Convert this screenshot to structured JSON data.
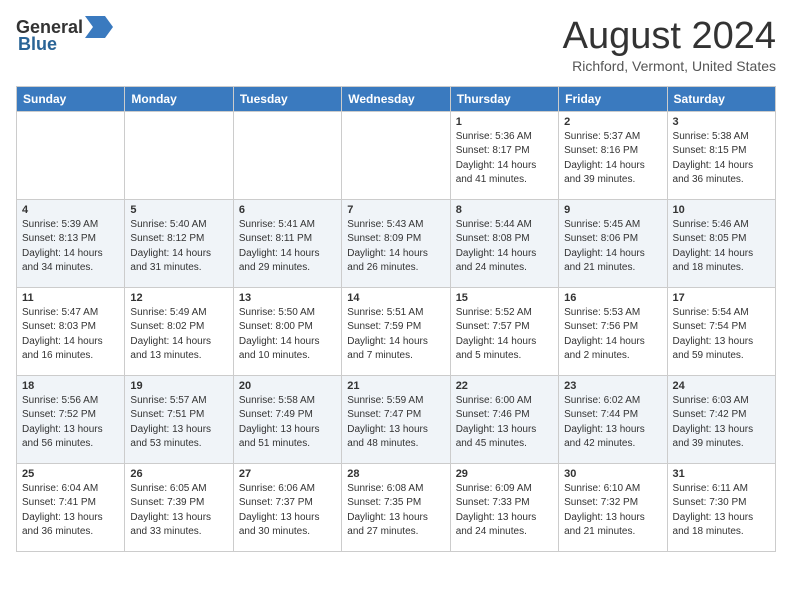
{
  "header": {
    "logo_general": "General",
    "logo_blue": "Blue",
    "month_title": "August 2024",
    "location": "Richford, Vermont, United States"
  },
  "days_of_week": [
    "Sunday",
    "Monday",
    "Tuesday",
    "Wednesday",
    "Thursday",
    "Friday",
    "Saturday"
  ],
  "weeks": [
    [
      {
        "day": "",
        "info": ""
      },
      {
        "day": "",
        "info": ""
      },
      {
        "day": "",
        "info": ""
      },
      {
        "day": "",
        "info": ""
      },
      {
        "day": "1",
        "info": "Sunrise: 5:36 AM\nSunset: 8:17 PM\nDaylight: 14 hours\nand 41 minutes."
      },
      {
        "day": "2",
        "info": "Sunrise: 5:37 AM\nSunset: 8:16 PM\nDaylight: 14 hours\nand 39 minutes."
      },
      {
        "day": "3",
        "info": "Sunrise: 5:38 AM\nSunset: 8:15 PM\nDaylight: 14 hours\nand 36 minutes."
      }
    ],
    [
      {
        "day": "4",
        "info": "Sunrise: 5:39 AM\nSunset: 8:13 PM\nDaylight: 14 hours\nand 34 minutes."
      },
      {
        "day": "5",
        "info": "Sunrise: 5:40 AM\nSunset: 8:12 PM\nDaylight: 14 hours\nand 31 minutes."
      },
      {
        "day": "6",
        "info": "Sunrise: 5:41 AM\nSunset: 8:11 PM\nDaylight: 14 hours\nand 29 minutes."
      },
      {
        "day": "7",
        "info": "Sunrise: 5:43 AM\nSunset: 8:09 PM\nDaylight: 14 hours\nand 26 minutes."
      },
      {
        "day": "8",
        "info": "Sunrise: 5:44 AM\nSunset: 8:08 PM\nDaylight: 14 hours\nand 24 minutes."
      },
      {
        "day": "9",
        "info": "Sunrise: 5:45 AM\nSunset: 8:06 PM\nDaylight: 14 hours\nand 21 minutes."
      },
      {
        "day": "10",
        "info": "Sunrise: 5:46 AM\nSunset: 8:05 PM\nDaylight: 14 hours\nand 18 minutes."
      }
    ],
    [
      {
        "day": "11",
        "info": "Sunrise: 5:47 AM\nSunset: 8:03 PM\nDaylight: 14 hours\nand 16 minutes."
      },
      {
        "day": "12",
        "info": "Sunrise: 5:49 AM\nSunset: 8:02 PM\nDaylight: 14 hours\nand 13 minutes."
      },
      {
        "day": "13",
        "info": "Sunrise: 5:50 AM\nSunset: 8:00 PM\nDaylight: 14 hours\nand 10 minutes."
      },
      {
        "day": "14",
        "info": "Sunrise: 5:51 AM\nSunset: 7:59 PM\nDaylight: 14 hours\nand 7 minutes."
      },
      {
        "day": "15",
        "info": "Sunrise: 5:52 AM\nSunset: 7:57 PM\nDaylight: 14 hours\nand 5 minutes."
      },
      {
        "day": "16",
        "info": "Sunrise: 5:53 AM\nSunset: 7:56 PM\nDaylight: 14 hours\nand 2 minutes."
      },
      {
        "day": "17",
        "info": "Sunrise: 5:54 AM\nSunset: 7:54 PM\nDaylight: 13 hours\nand 59 minutes."
      }
    ],
    [
      {
        "day": "18",
        "info": "Sunrise: 5:56 AM\nSunset: 7:52 PM\nDaylight: 13 hours\nand 56 minutes."
      },
      {
        "day": "19",
        "info": "Sunrise: 5:57 AM\nSunset: 7:51 PM\nDaylight: 13 hours\nand 53 minutes."
      },
      {
        "day": "20",
        "info": "Sunrise: 5:58 AM\nSunset: 7:49 PM\nDaylight: 13 hours\nand 51 minutes."
      },
      {
        "day": "21",
        "info": "Sunrise: 5:59 AM\nSunset: 7:47 PM\nDaylight: 13 hours\nand 48 minutes."
      },
      {
        "day": "22",
        "info": "Sunrise: 6:00 AM\nSunset: 7:46 PM\nDaylight: 13 hours\nand 45 minutes."
      },
      {
        "day": "23",
        "info": "Sunrise: 6:02 AM\nSunset: 7:44 PM\nDaylight: 13 hours\nand 42 minutes."
      },
      {
        "day": "24",
        "info": "Sunrise: 6:03 AM\nSunset: 7:42 PM\nDaylight: 13 hours\nand 39 minutes."
      }
    ],
    [
      {
        "day": "25",
        "info": "Sunrise: 6:04 AM\nSunset: 7:41 PM\nDaylight: 13 hours\nand 36 minutes."
      },
      {
        "day": "26",
        "info": "Sunrise: 6:05 AM\nSunset: 7:39 PM\nDaylight: 13 hours\nand 33 minutes."
      },
      {
        "day": "27",
        "info": "Sunrise: 6:06 AM\nSunset: 7:37 PM\nDaylight: 13 hours\nand 30 minutes."
      },
      {
        "day": "28",
        "info": "Sunrise: 6:08 AM\nSunset: 7:35 PM\nDaylight: 13 hours\nand 27 minutes."
      },
      {
        "day": "29",
        "info": "Sunrise: 6:09 AM\nSunset: 7:33 PM\nDaylight: 13 hours\nand 24 minutes."
      },
      {
        "day": "30",
        "info": "Sunrise: 6:10 AM\nSunset: 7:32 PM\nDaylight: 13 hours\nand 21 minutes."
      },
      {
        "day": "31",
        "info": "Sunrise: 6:11 AM\nSunset: 7:30 PM\nDaylight: 13 hours\nand 18 minutes."
      }
    ]
  ]
}
